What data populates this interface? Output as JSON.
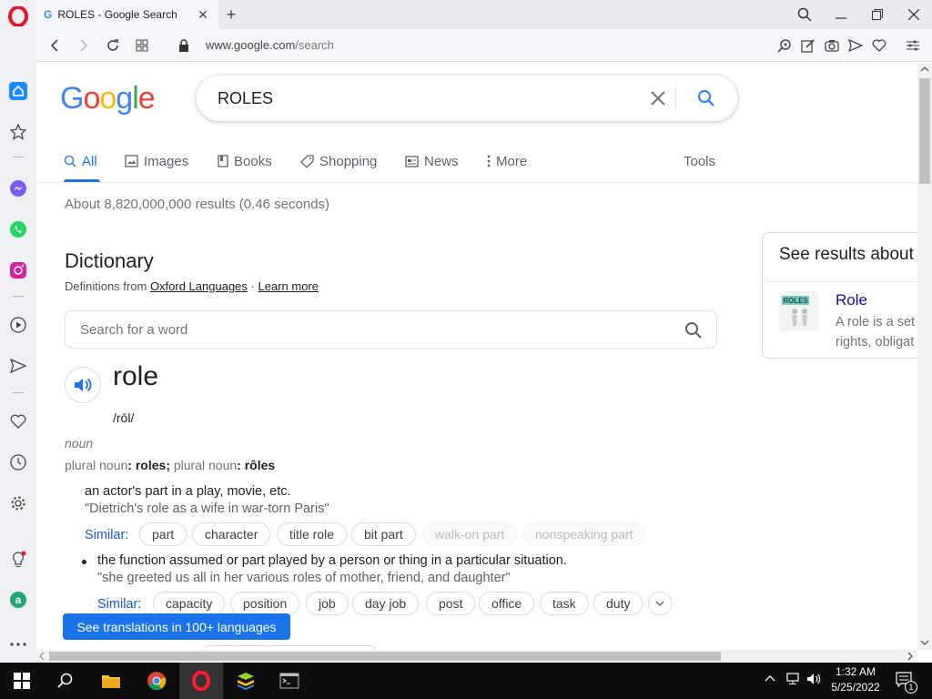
{
  "browser": {
    "tab_title": "ROLES - Google Search",
    "tab_favicon": "G",
    "url_host": "www.google.com",
    "url_path": "/search"
  },
  "google": {
    "logo_letters": [
      "G",
      "o",
      "o",
      "g",
      "l",
      "e"
    ],
    "logo_colors": [
      "#4285f4",
      "#ea4335",
      "#fbbc05",
      "#4285f4",
      "#34a853",
      "#ea4335"
    ],
    "query": "ROLES",
    "tabs": [
      {
        "label": "All",
        "icon": "search-icon",
        "active": true
      },
      {
        "label": "Images",
        "icon": "image-icon"
      },
      {
        "label": "Books",
        "icon": "book-icon"
      },
      {
        "label": "Shopping",
        "icon": "tag-icon"
      },
      {
        "label": "News",
        "icon": "news-icon"
      },
      {
        "label": "More",
        "icon": "more-vert-icon"
      }
    ],
    "tools_label": "Tools",
    "stats": "About 8,820,000,000 results (0.46 seconds)"
  },
  "dictionary": {
    "title": "Dictionary",
    "defs_from": "Definitions from",
    "source": "Oxford Languages",
    "sep": "·",
    "learn_more": "Learn more",
    "search_placeholder": "Search for a word",
    "word": "role",
    "phonetic": "/rōl/",
    "pos": "noun",
    "plural_label_1": "plural noun",
    "plural_1": "roles",
    "plural_sep": ";",
    "plural_label_2": "plural noun",
    "plural_2": "rôles",
    "colon": ":",
    "def1": "an actor's part in a play, movie, etc.",
    "ex1": "\"Dietrich's role as a wife in war-torn Paris\"",
    "similar_label": "Similar:",
    "similar1": [
      "part",
      "character",
      "title role",
      "bit part",
      "walk-on part",
      "nonspeaking part"
    ],
    "def2": "the function assumed or part played by a person or thing in a particular situation.",
    "ex2": "\"she greeted us all in her various roles of mother, friend, and daughter\"",
    "similar2": [
      "capacity",
      "position",
      "job",
      "day job",
      "post",
      "office",
      "task",
      "duty"
    ],
    "translate_button": "See translations in 100+ languages"
  },
  "knowledge_panel": {
    "title": "See results about",
    "name": "Role",
    "desc_line1": "A role is a set",
    "desc_line2": "rights, obligat",
    "thumb_text": "ROLES"
  },
  "taskbar": {
    "time": "1:32 AM",
    "date": "5/25/2022",
    "notification_count": "1"
  }
}
